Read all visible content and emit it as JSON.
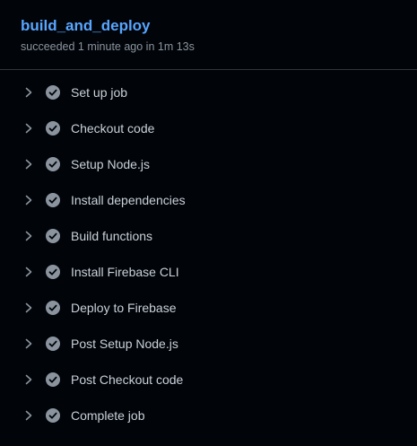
{
  "job": {
    "title": "build_and_deploy",
    "status_text": "succeeded 1 minute ago in 1m 13s"
  },
  "steps": [
    {
      "label": "Set up job",
      "status": "success",
      "icon": "check-circle-icon"
    },
    {
      "label": "Checkout code",
      "status": "success",
      "icon": "check-circle-icon"
    },
    {
      "label": "Setup Node.js",
      "status": "success",
      "icon": "check-circle-icon"
    },
    {
      "label": "Install dependencies",
      "status": "success",
      "icon": "check-circle-icon"
    },
    {
      "label": "Build functions",
      "status": "success",
      "icon": "check-circle-icon"
    },
    {
      "label": "Install Firebase CLI",
      "status": "success",
      "icon": "check-circle-icon"
    },
    {
      "label": "Deploy to Firebase",
      "status": "success",
      "icon": "check-circle-icon"
    },
    {
      "label": "Post Setup Node.js",
      "status": "success",
      "icon": "check-circle-icon"
    },
    {
      "label": "Post Checkout code",
      "status": "success",
      "icon": "check-circle-icon"
    },
    {
      "label": "Complete job",
      "status": "success",
      "icon": "check-circle-icon"
    }
  ],
  "colors": {
    "background": "#010409",
    "title_link": "#58a6ff",
    "muted_text": "#8b949e",
    "step_text": "#c9d1d9",
    "check_icon": "#8b949e",
    "divider": "#30363d"
  }
}
